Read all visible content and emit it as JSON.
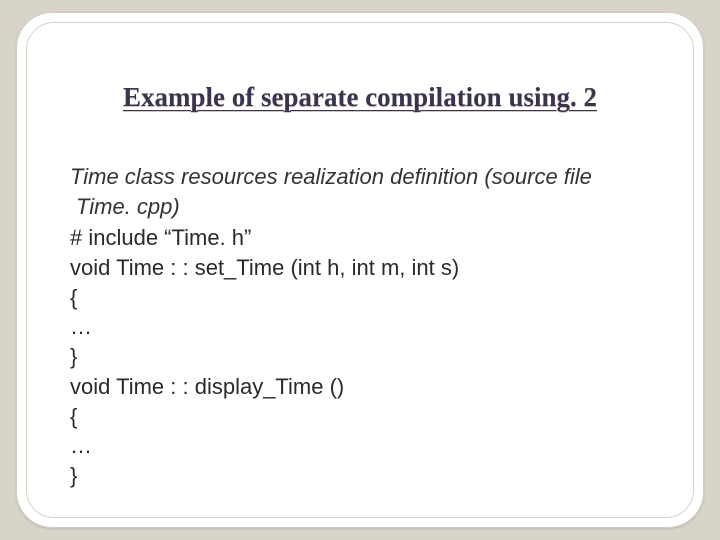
{
  "slide": {
    "title": "Example of separate compilation using. 2",
    "description": "Time class resources realization definition (source file Time. cpp)",
    "code_lines": [
      "# include “Time. h”",
      "void Time : : set_Time (int h, int m, int s)",
      "{",
      "…",
      "}",
      "void Time : : display_Time ()",
      "{",
      "…",
      "}"
    ]
  }
}
